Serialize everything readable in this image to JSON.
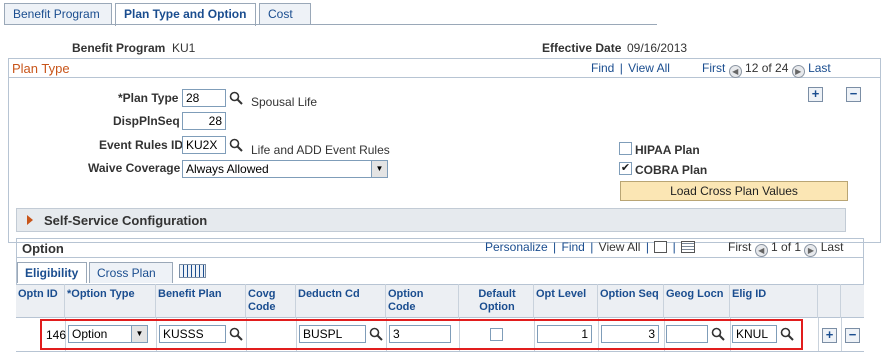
{
  "tabs": [
    {
      "label": "Benefit Program",
      "active": false
    },
    {
      "label": "Plan Type and Option",
      "active": true
    },
    {
      "label": "Cost",
      "active": false
    }
  ],
  "header": {
    "benefit_program_label": "Benefit Program",
    "benefit_program_value": "KU1",
    "effective_date_label": "Effective Date",
    "effective_date_value": "09/16/2013"
  },
  "plan_type_section": {
    "title": "Plan Type",
    "nav": {
      "find": "Find",
      "view_all": "View All",
      "first": "First",
      "count": "12 of 24",
      "last": "Last"
    },
    "plan_type_label": "*Plan Type",
    "plan_type_value": "28",
    "plan_type_desc": "Spousal Life",
    "displnseq_label": "DispPlnSeq",
    "displnseq_value": "28",
    "event_rules_label": "Event Rules ID",
    "event_rules_value": "KU2X",
    "event_rules_desc": "Life and ADD Event Rules",
    "waive_label": "Waive Coverage",
    "waive_value": "Always Allowed",
    "hipaa_label": "HIPAA Plan",
    "hipaa_checked": false,
    "cobra_label": "COBRA Plan",
    "cobra_checked": true,
    "load_button": "Load Cross Plan Values",
    "add": "+",
    "remove": "−"
  },
  "self_service": {
    "title": "Self-Service Configuration"
  },
  "option_section": {
    "title": "Option",
    "nav": {
      "personalize": "Personalize",
      "find": "Find",
      "view_all": "View All",
      "first": "First",
      "count": "1 of 1",
      "last": "Last"
    },
    "subtabs": [
      {
        "label": "Eligibility",
        "active": true
      },
      {
        "label": "Cross Plan",
        "active": false
      }
    ],
    "columns": [
      "Optn ID",
      "*Option Type",
      "Benefit Plan",
      "Covg\nCode",
      "Deductn Cd",
      "Option\nCode",
      "Default\nOption",
      "Opt Level",
      "Option Seq",
      "Geog Locn",
      "Elig ID"
    ],
    "row": {
      "optn_id": "146",
      "option_type": "Option",
      "benefit_plan": "KUSSS",
      "covg_code": "",
      "deductn_cd": "BUSPL",
      "option_code": "3",
      "default_option": false,
      "opt_level": "1",
      "option_seq": "3",
      "geog_locn": "",
      "elig_id": "KNUL"
    },
    "add": "+",
    "remove": "−"
  },
  "colors": {
    "accent": "#1a4d8f",
    "section_title": "#c8551a",
    "highlight": "#e11d1d",
    "button": "#fbe6b4"
  }
}
